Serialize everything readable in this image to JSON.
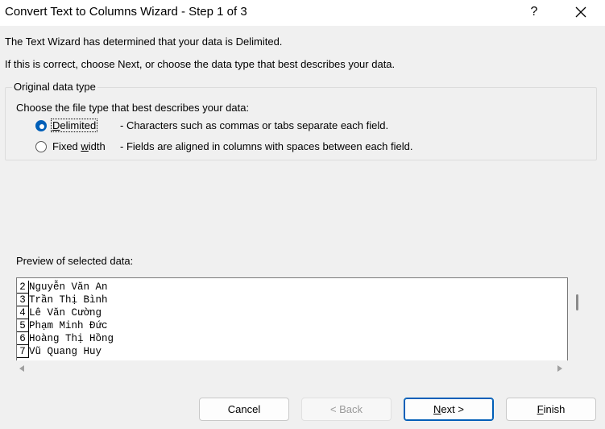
{
  "window": {
    "title": "Convert Text to Columns Wizard - Step 1 of 3",
    "help_glyph": "?"
  },
  "messages": {
    "line1": "The Text Wizard has determined that your data is Delimited.",
    "line2": "If this is correct, choose Next, or choose the data type that best describes your data."
  },
  "original_data_type": {
    "group_title": "Original data type",
    "prompt": "Choose the file type that best describes your data:",
    "options": [
      {
        "label_pre": "",
        "label_accel": "D",
        "label_post": "elimited",
        "description": "- Characters such as commas or tabs separate each field.",
        "selected": true
      },
      {
        "label_pre": "Fixed ",
        "label_accel": "w",
        "label_post": "idth",
        "description": "- Fields are aligned in columns with spaces between each field.",
        "selected": false
      }
    ]
  },
  "preview": {
    "label": "Preview of selected data:",
    "rows": [
      {
        "num": "2",
        "text": "Nguyễn Văn An"
      },
      {
        "num": "3",
        "text": "Trần Thị Bình"
      },
      {
        "num": "4",
        "text": "Lê Văn Cường"
      },
      {
        "num": "5",
        "text": "Phạm Minh Đức"
      },
      {
        "num": "6",
        "text": "Hoàng Thị Hồng"
      },
      {
        "num": "7",
        "text": "Vũ Quang Huy"
      }
    ]
  },
  "buttons": {
    "cancel": "Cancel",
    "back": "< Back",
    "next_accel": "N",
    "next_rest": "ext >",
    "finish_accel": "F",
    "finish_rest": "inish"
  },
  "colors": {
    "accent": "#005fb8",
    "dialog_bg": "#f0f0f0"
  }
}
